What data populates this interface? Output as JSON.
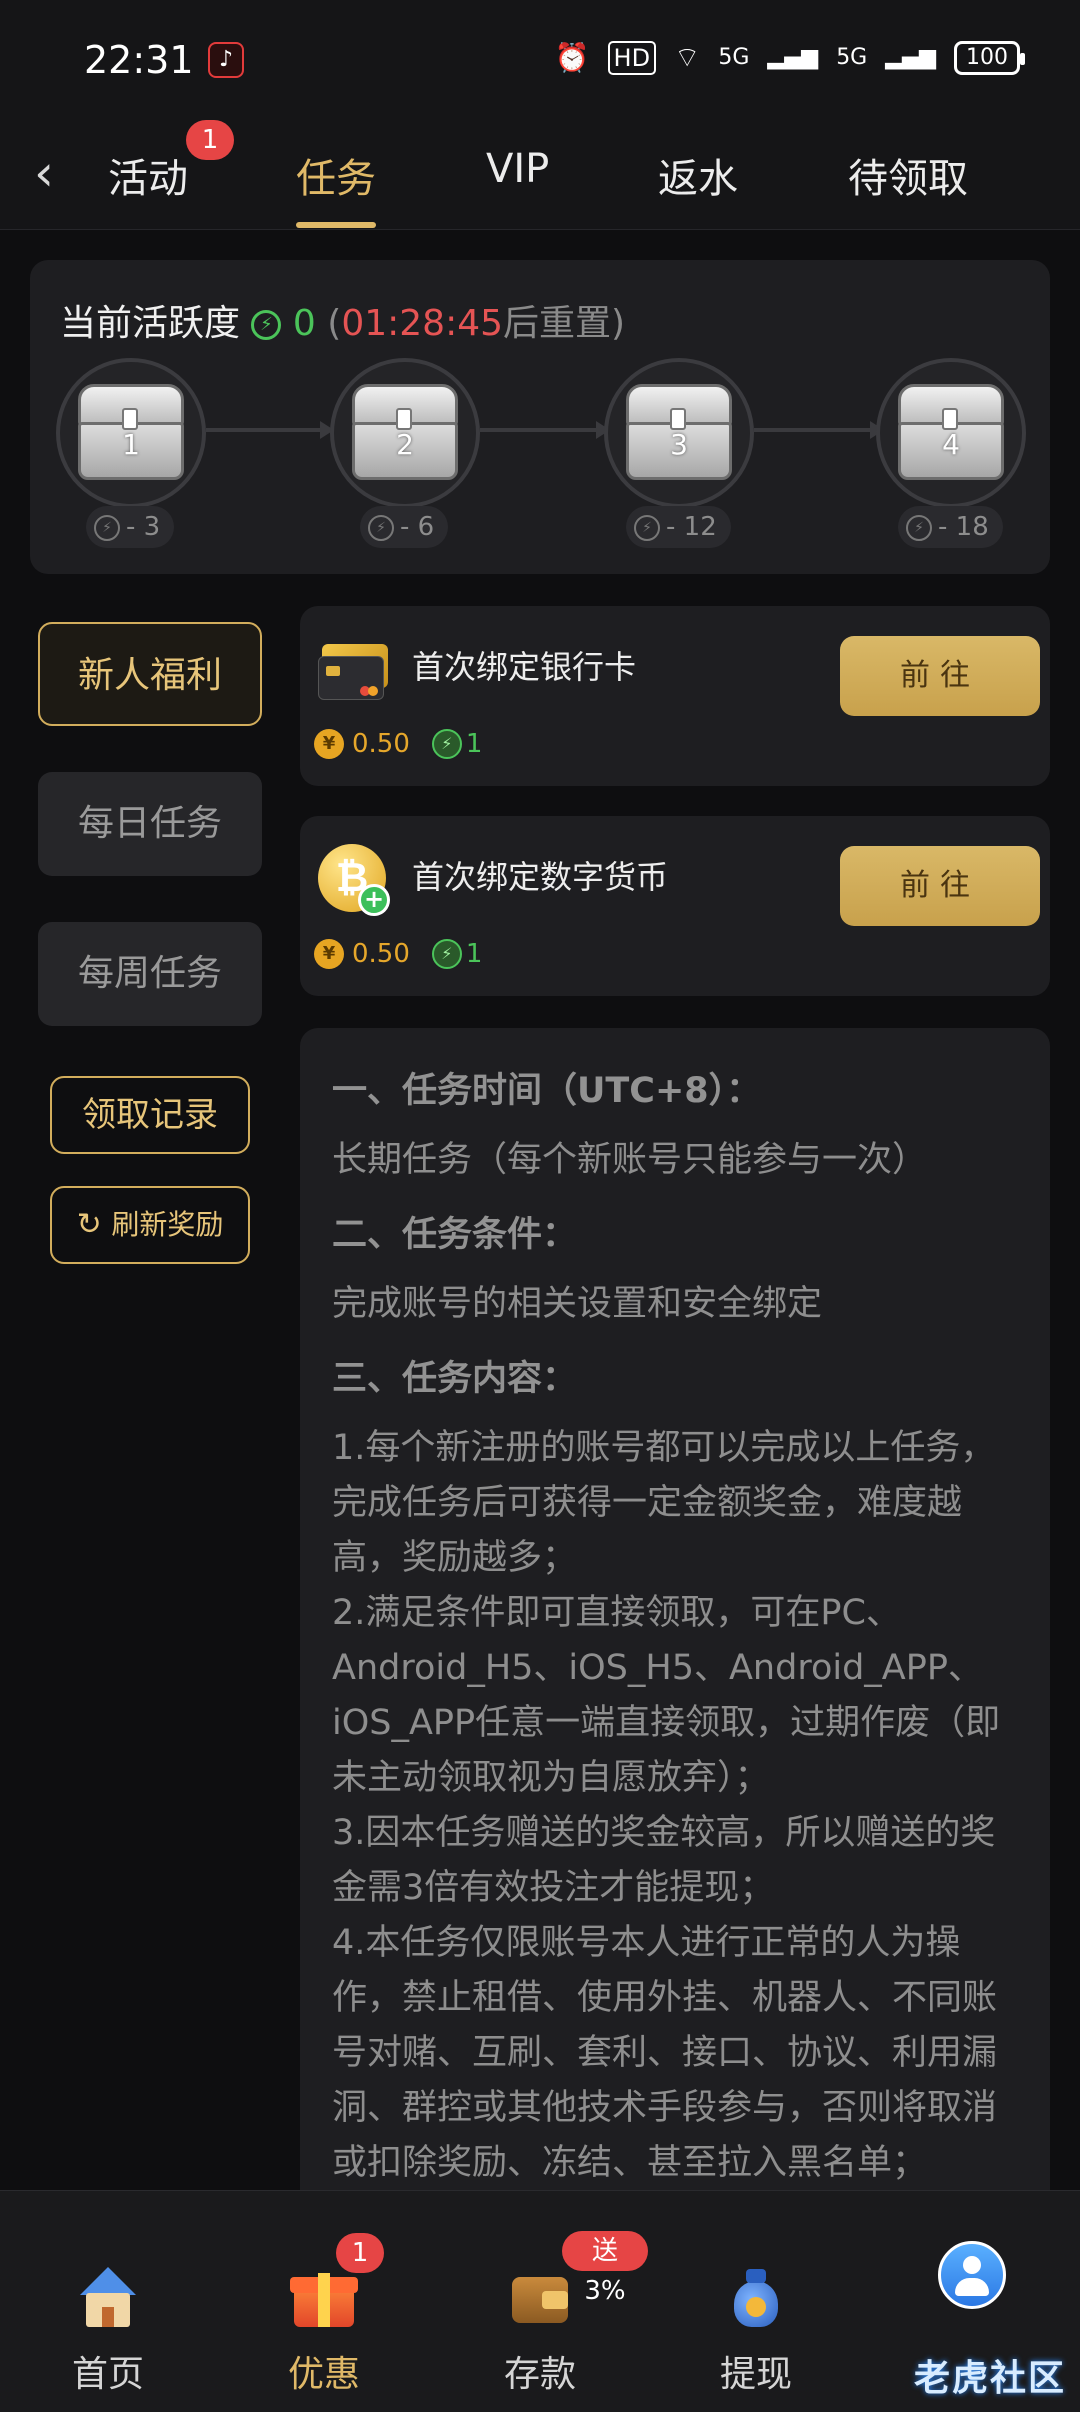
{
  "status": {
    "time": "22:31",
    "battery": "100",
    "hd": "HD",
    "net1": "5G",
    "net2": "5G"
  },
  "tabs": {
    "back": "‹",
    "items": [
      {
        "label": "活动",
        "badge": "1"
      },
      {
        "label": "任务",
        "active": true
      },
      {
        "label": "VIP"
      },
      {
        "label": "返水"
      },
      {
        "label": "待领取"
      }
    ]
  },
  "activity": {
    "title": "当前活跃度",
    "value": "0",
    "paren_open": "(",
    "countdown": "01:28:45",
    "reset_text": "后重置)",
    "chests": [
      {
        "num": "1",
        "cost": "- 3"
      },
      {
        "num": "2",
        "cost": "- 6"
      },
      {
        "num": "3",
        "cost": "- 12"
      },
      {
        "num": "4",
        "cost": "- 18"
      }
    ]
  },
  "left_menu": {
    "items": [
      "新人福利",
      "每日任务",
      "每周任务"
    ],
    "records": "领取记录",
    "refresh": "刷新奖励"
  },
  "tasks": [
    {
      "title": "首次绑定银行卡",
      "button": "前往",
      "money": "0.50",
      "points": "1",
      "icon": "bank-card"
    },
    {
      "title": "首次绑定数字货币",
      "button": "前往",
      "money": "0.50",
      "points": "1",
      "icon": "bitcoin"
    }
  ],
  "rules": {
    "h1": "一、任务时间（UTC+8）：",
    "p1": "长期任务（每个新账号只能参与一次）",
    "h2": "二、任务条件：",
    "p2": "完成账号的相关设置和安全绑定",
    "h3": "三、任务内容：",
    "items": [
      "1.每个新注册的账号都可以完成以上任务，完成任务后可获得一定金额奖金，难度越高，奖励越多；",
      "2.满足条件即可直接领取，可在PC、Android_H5、iOS_H5、Android_APP、iOS_APP任意一端直接领取，过期作废（即未主动领取视为自愿放弃）；",
      "3.因本任务赠送的奖金较高，所以赠送的奖金需3倍有效投注才能提现；",
      "4.本任务仅限账号本人进行正常的人为操作，禁止租借、使用外挂、机器人、不同账号对赌、互刷、套利、接口、协议、利用漏洞、群控或其他技术手段参与，否则将取消或扣除奖励、冻结、甚至拉入黑名单；"
    ]
  },
  "bottom_nav": {
    "items": [
      {
        "label": "首页",
        "icon": "home-icon"
      },
      {
        "label": "优惠",
        "icon": "gift-icon",
        "badge": "1",
        "active": true
      },
      {
        "label": "存款",
        "icon": "wallet-icon",
        "badge": "送3%"
      },
      {
        "label": "提现",
        "icon": "money-bag-icon"
      },
      {
        "label": "",
        "icon": "profile-icon"
      }
    ],
    "watermark": "老虎社区"
  },
  "colors": {
    "accent": "#e0b968",
    "green": "#4bc45a",
    "red": "#e55454",
    "bg": "#0e0e10",
    "card": "#1e1e21"
  }
}
